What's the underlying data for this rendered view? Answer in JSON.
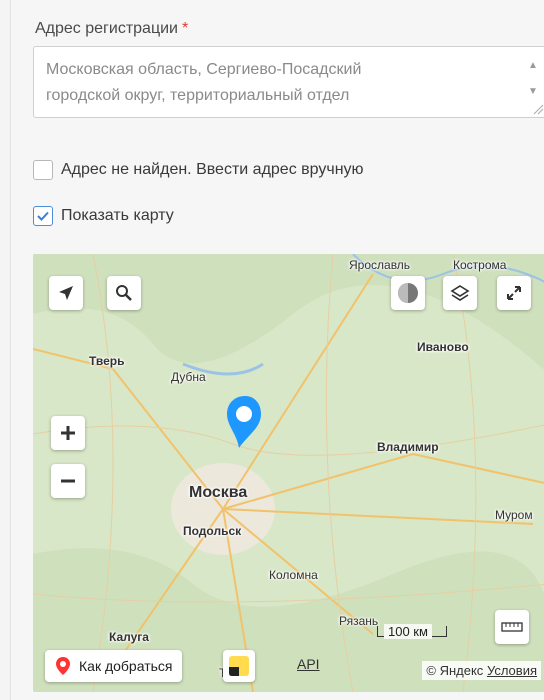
{
  "form": {
    "address_label": "Адрес регистрации",
    "required_mark": "*",
    "address_value_line1": "Московская область, Сергиево-Посадский",
    "address_value_line2": "городской округ, территориальный отдел",
    "manual_checkbox_label": "Адрес не найден. Ввести адрес вручную",
    "manual_checked": false,
    "show_map_label": "Показать карту",
    "show_map_checked": true
  },
  "map": {
    "cities": [
      "Ярославль",
      "Кострома",
      "Иваново",
      "Тверь",
      "Дубна",
      "Владимир",
      "Москва",
      "Подольск",
      "Муром",
      "Коломна",
      "Рязань",
      "Калуга",
      "Ту"
    ],
    "route_button_label": "Как добраться",
    "api_link": "API",
    "copyright": "© Яндекс",
    "terms_link": "Условия",
    "scale_label": "100 км",
    "icons": [
      "locate-arrow-icon",
      "search-icon",
      "traffic-icon",
      "layers-icon",
      "fullscreen-icon",
      "zoom-in-icon",
      "zoom-out-icon",
      "ruler-icon",
      "map-marker-icon",
      "yandex-logo-icon"
    ],
    "colors": {
      "map_bg": "#d8e7c7",
      "city_area": "#ece8dc",
      "road": "#f2c26b",
      "marker": "#1e98ff"
    }
  }
}
